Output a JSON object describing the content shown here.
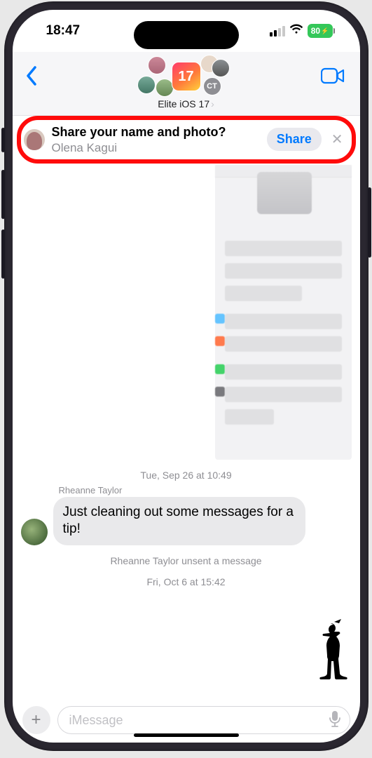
{
  "status": {
    "time": "18:47",
    "battery": "80"
  },
  "nav": {
    "chat_title": "Elite iOS 17",
    "group_initials": "CT",
    "app_badge": "17"
  },
  "banner": {
    "title": "Share your name and photo?",
    "subtitle": "Olena Kagui",
    "share_label": "Share"
  },
  "chat": {
    "ts1": "Tue, Sep 26 at 10:49",
    "sender1": "Rheanne Taylor",
    "msg1": "Just cleaning out some messages for a tip!",
    "unsent": "Rheanne Taylor unsent a message",
    "ts2": "Fri, Oct 6 at 15:42"
  },
  "input": {
    "placeholder": "iMessage"
  }
}
